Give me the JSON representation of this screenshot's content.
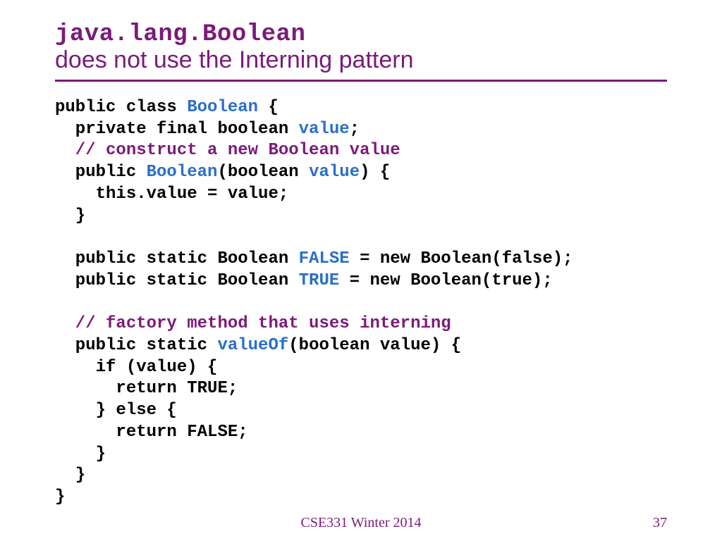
{
  "title": {
    "line1": "java.lang.Boolean",
    "line2": "does not use the Interning pattern"
  },
  "code": {
    "l1a": "public class ",
    "l1b": "Boolean",
    "l1c": " {",
    "l2a": "  private final boolean ",
    "l2b": "value",
    "l2c": ";",
    "l3": "  // construct a new Boolean value",
    "l4a": "  public ",
    "l4b": "Boolean",
    "l4c": "(boolean ",
    "l4d": "value",
    "l4e": ") {",
    "l5": "    this.value = value;",
    "l6": "  }",
    "l7": "",
    "l8a": "  public static Boolean ",
    "l8b": "FALSE",
    "l8c": " = new Boolean(false);",
    "l9a": "  public static Boolean ",
    "l9b": "TRUE",
    "l9c": " = new Boolean(true);",
    "l10": "",
    "l11": "  // factory method that uses interning",
    "l12a": "  public static ",
    "l12b": "valueOf",
    "l12c": "(boolean value) {",
    "l13": "    if (value) {",
    "l14": "      return TRUE;",
    "l15": "    } else {",
    "l16": "      return FALSE;",
    "l17": "    }",
    "l18": "  }",
    "l19": "}"
  },
  "footer": {
    "course": "CSE331 Winter 2014",
    "page": "37"
  }
}
